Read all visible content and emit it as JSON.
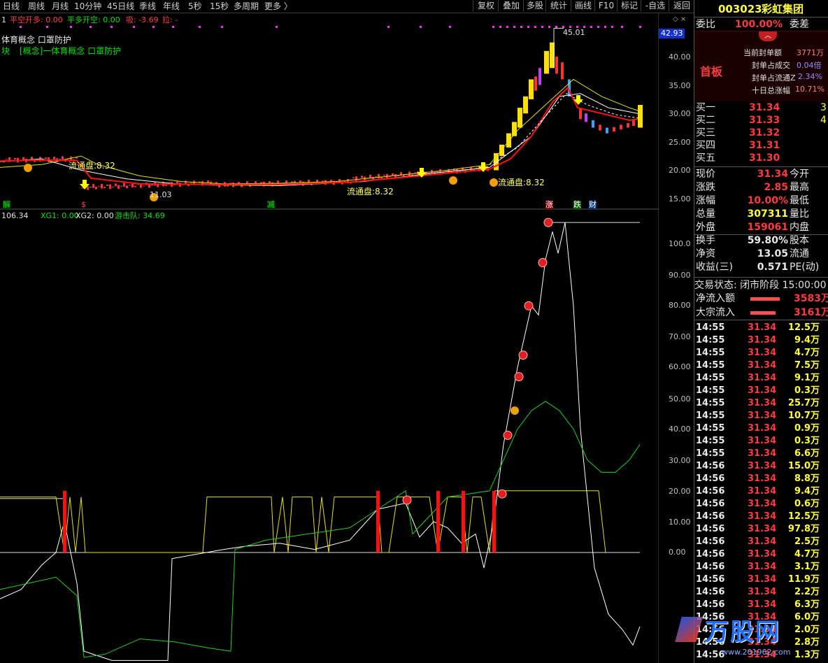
{
  "toolbar": {
    "periods": [
      "日线",
      "周线",
      "月线",
      "10分钟",
      "45日线",
      "季线",
      "年线",
      "5秒",
      "15秒",
      "多周期",
      "更多 〉"
    ],
    "buttons": [
      "复权",
      "叠加",
      "多股",
      "统计",
      "画线",
      "F10",
      "标记",
      "-自选",
      "返回"
    ]
  },
  "main_indicators": {
    "line1_prefix": "1",
    "item1": "平空开多: 0.00",
    "item2": "平多开空: 0.00",
    "item3": "吸: -3.69",
    "item4": "拉: -",
    "concept1": "体育概念 口罩防护",
    "concept2_prefix": "块",
    "concept2": "[概念]一体育概念 口罩防护"
  },
  "main_chart": {
    "price_axis": [
      "40.00",
      "35.00",
      "30.00",
      "25.00",
      "20.00",
      "15.00"
    ],
    "current_price_tag": "42.93",
    "high_label": "45.01",
    "low_label": "11.03",
    "flow_labels": [
      "流通盘:8.32",
      "流通盘:8.32",
      "流通盘:8.32"
    ],
    "bottom_marks": [
      "解",
      "$",
      "减",
      "涨",
      "跌",
      "财"
    ]
  },
  "sub_indicators": {
    "item1": "106.34",
    "item2": "XG1: 0.00",
    "item3": "XG2: 0.00",
    "item4": "游击队: 34.69",
    "axis": [
      "100.0",
      "90.00",
      "80.00",
      "70.00",
      "60.00",
      "50.00",
      "40.00",
      "30.00",
      "20.00",
      "10.00",
      "0.00"
    ]
  },
  "stock": {
    "code": "003023",
    "name": "彩虹集团",
    "weibi_label": "委比",
    "weibi_value": "100.00%",
    "weicha_label": "委差",
    "board": "首板",
    "stats": [
      {
        "label": "当前封单额",
        "value": "3771万"
      },
      {
        "label": "封单占成交",
        "value": "0.04倍"
      },
      {
        "label": "封单占流通Z",
        "value": "2.34%"
      },
      {
        "label": "十日总涨幅",
        "value": "10.71%"
      }
    ],
    "bids": [
      {
        "label": "买一",
        "price": "31.34",
        "vol": "3"
      },
      {
        "label": "买二",
        "price": "31.33",
        "vol": "4"
      },
      {
        "label": "买三",
        "price": "31.32",
        "vol": ""
      },
      {
        "label": "买四",
        "price": "31.31",
        "vol": ""
      },
      {
        "label": "买五",
        "price": "31.30",
        "vol": ""
      }
    ],
    "quote": [
      {
        "l": "现价",
        "v": "31.34",
        "l2": "今开",
        "c": "red"
      },
      {
        "l": "涨跌",
        "v": "2.85",
        "l2": "最高",
        "c": "red"
      },
      {
        "l": "涨幅",
        "v": "10.00%",
        "l2": "最低",
        "c": "red"
      },
      {
        "l": "总量",
        "v": "307311",
        "l2": "量比",
        "c": "yel"
      },
      {
        "l": "外盘",
        "v": "159061",
        "l2": "内盘",
        "c": "red"
      },
      {
        "l": "换手",
        "v": "59.80%",
        "l2": "股本",
        "c": "wht"
      },
      {
        "l": "净资",
        "v": "13.05",
        "l2": "流通",
        "c": "wht"
      },
      {
        "l": "收益(三)",
        "v": "0.571",
        "l2": "PE(动)",
        "c": "wht"
      }
    ],
    "trade_status": "交易状态: 闭市阶段 15:00:00",
    "net_inflow_label": "净流入额",
    "net_inflow_value": "3583万",
    "block_inflow_label": "大宗流入",
    "block_inflow_value": "3161万"
  },
  "ticks": [
    {
      "t": "14:55",
      "p": "31.34",
      "v": "12.5万"
    },
    {
      "t": "14:55",
      "p": "31.34",
      "v": "9.4万"
    },
    {
      "t": "14:55",
      "p": "31.34",
      "v": "4.7万"
    },
    {
      "t": "14:55",
      "p": "31.34",
      "v": "7.5万"
    },
    {
      "t": "14:55",
      "p": "31.34",
      "v": "9.1万"
    },
    {
      "t": "14:55",
      "p": "31.34",
      "v": "0.3万"
    },
    {
      "t": "14:55",
      "p": "31.34",
      "v": "25.7万"
    },
    {
      "t": "14:55",
      "p": "31.34",
      "v": "10.7万"
    },
    {
      "t": "14:55",
      "p": "31.34",
      "v": "0.9万"
    },
    {
      "t": "14:55",
      "p": "31.34",
      "v": "0.3万"
    },
    {
      "t": "14:55",
      "p": "31.34",
      "v": "6.6万"
    },
    {
      "t": "14:56",
      "p": "31.34",
      "v": "15.0万"
    },
    {
      "t": "14:56",
      "p": "31.34",
      "v": "8.8万"
    },
    {
      "t": "14:56",
      "p": "31.34",
      "v": "9.4万"
    },
    {
      "t": "14:56",
      "p": "31.34",
      "v": "0.6万"
    },
    {
      "t": "14:56",
      "p": "31.34",
      "v": "12.5万"
    },
    {
      "t": "14:56",
      "p": "31.34",
      "v": "97.8万"
    },
    {
      "t": "14:56",
      "p": "31.34",
      "v": "2.5万"
    },
    {
      "t": "14:56",
      "p": "31.34",
      "v": "4.7万"
    },
    {
      "t": "14:56",
      "p": "31.34",
      "v": "3.1万"
    },
    {
      "t": "14:56",
      "p": "31.34",
      "v": "11.9万"
    },
    {
      "t": "14:56",
      "p": "31.34",
      "v": "2.2万"
    },
    {
      "t": "14:56",
      "p": "31.34",
      "v": "6.3万"
    },
    {
      "t": "14:56",
      "p": "31.34",
      "v": "6.0万"
    },
    {
      "t": "14:56",
      "p": "31.34",
      "v": "2.0万"
    },
    {
      "t": "14:56",
      "p": "31.34",
      "v": "2.8万"
    },
    {
      "t": "14:56",
      "p": "31.34",
      "v": "1.3万"
    }
  ],
  "watermark": {
    "brand": "万股网",
    "url": "www.201962.com"
  }
}
